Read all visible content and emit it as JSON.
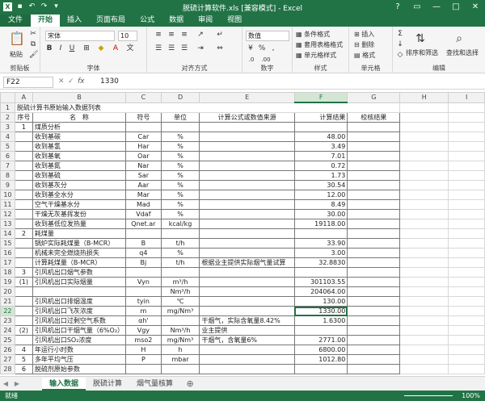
{
  "window": {
    "title": "脱硫计算软件.xls  [兼容模式] - Excel",
    "controls": {
      "help": "?",
      "ribbon": "▭",
      "minimize": "—",
      "restore": "□",
      "close": "✕"
    }
  },
  "tabs": [
    "文件",
    "开始",
    "插入",
    "页面布局",
    "公式",
    "数据",
    "审阅",
    "视图"
  ],
  "ribbon": {
    "clipboard": {
      "label": "剪贴板",
      "paste": "粘贴"
    },
    "font": {
      "label": "字体",
      "name": "宋体",
      "size": "10"
    },
    "alignment": {
      "label": "对齐方式"
    },
    "number": {
      "label": "数字",
      "format": "数值"
    },
    "styles": {
      "label": "样式",
      "conditional": "条件格式",
      "table": "套用表格格式",
      "cell": "单元格样式"
    },
    "cells": {
      "label": "单元格",
      "insert": "插入",
      "delete": "删除",
      "format": "格式"
    },
    "editing": {
      "label": "编辑",
      "sort": "排序和筛选",
      "find": "查找和选择"
    }
  },
  "formula_bar": {
    "name_box": "F22",
    "fx": "fx",
    "value": "1330"
  },
  "grid": {
    "columns": [
      "A",
      "B",
      "C",
      "D",
      "E",
      "F",
      "G",
      "H",
      "I"
    ],
    "selected_col": "F",
    "selected_row": "22",
    "rows": [
      {
        "n": "1",
        "a": "脱硫计算书原始输入数据列表",
        "b": "",
        "c": "",
        "d": "",
        "e": "",
        "f": "",
        "g": ""
      },
      {
        "n": "2",
        "a": "序号",
        "b": "名　称",
        "c": "符号",
        "d": "单位",
        "e": "计算公式或数值来源",
        "f": "计算结果",
        "g": "校核结果"
      },
      {
        "n": "3",
        "a": "1",
        "b": "煤质分析",
        "c": "",
        "d": "",
        "e": "",
        "f": "",
        "g": ""
      },
      {
        "n": "4",
        "a": "",
        "b": "收到基碳",
        "c": "Car",
        "d": "%",
        "e": "",
        "f": "48.00",
        "g": ""
      },
      {
        "n": "5",
        "a": "",
        "b": "收到基氢",
        "c": "Har",
        "d": "%",
        "e": "",
        "f": "3.49",
        "g": ""
      },
      {
        "n": "6",
        "a": "",
        "b": "收到基氧",
        "c": "Oar",
        "d": "%",
        "e": "",
        "f": "7.01",
        "g": ""
      },
      {
        "n": "7",
        "a": "",
        "b": "收到基氮",
        "c": "Nar",
        "d": "%",
        "e": "",
        "f": "0.72",
        "g": ""
      },
      {
        "n": "8",
        "a": "",
        "b": "收到基硫",
        "c": "Sar",
        "d": "%",
        "e": "",
        "f": "1.73",
        "g": ""
      },
      {
        "n": "9",
        "a": "",
        "b": "收到基灰分",
        "c": "Aar",
        "d": "%",
        "e": "",
        "f": "30.54",
        "g": ""
      },
      {
        "n": "10",
        "a": "",
        "b": "收到基全水分",
        "c": "Mar",
        "d": "%",
        "e": "",
        "f": "12.00",
        "g": ""
      },
      {
        "n": "11",
        "a": "",
        "b": "空气干燥基水分",
        "c": "Mad",
        "d": "%",
        "e": "",
        "f": "8.49",
        "g": ""
      },
      {
        "n": "12",
        "a": "",
        "b": "干燥无灰基挥发份",
        "c": "Vdaf",
        "d": "%",
        "e": "",
        "f": "30.00",
        "g": ""
      },
      {
        "n": "13",
        "a": "",
        "b": "收到基低位发热量",
        "c": "Qnet.ar",
        "d": "kcal/kg",
        "e": "",
        "f": "19118.00",
        "g": ""
      },
      {
        "n": "14",
        "a": "2",
        "b": "耗煤量",
        "c": "",
        "d": "",
        "e": "",
        "f": "",
        "g": ""
      },
      {
        "n": "15",
        "a": "",
        "b": "锅炉实际耗煤量（B-MCR）",
        "c": "B",
        "d": "t/h",
        "e": "",
        "f": "33.90",
        "g": ""
      },
      {
        "n": "16",
        "a": "",
        "b": "机械未完全燃烧热损失",
        "c": "q4",
        "d": "%",
        "e": "",
        "f": "3.00",
        "g": ""
      },
      {
        "n": "17",
        "a": "",
        "b": "计算耗煤量（B-MCR）",
        "c": "Bj",
        "d": "t/h",
        "e": "根据业主提供实际烟气量试算",
        "f": "32.8830",
        "g": ""
      },
      {
        "n": "18",
        "a": "3",
        "b": "引风机出口烟气参数",
        "c": "",
        "d": "",
        "e": "",
        "f": "",
        "g": ""
      },
      {
        "n": "19",
        "a": "(1)",
        "b": "引风机出口实际烟量",
        "c": "Vyn",
        "d": "m³/h",
        "e": "",
        "f": "301103.55",
        "g": ""
      },
      {
        "n": "20",
        "a": "",
        "b": "",
        "c": "",
        "d": "Nm³/h",
        "e": "",
        "f": "204064.00",
        "g": ""
      },
      {
        "n": "21",
        "a": "",
        "b": "引风机出口排烟温度",
        "c": "tyin",
        "d": "℃",
        "e": "",
        "f": "130.00",
        "g": ""
      },
      {
        "n": "22",
        "a": "",
        "b": "引风机出口飞灰浓度",
        "c": "m",
        "d": "mg/Nm³",
        "e": "",
        "f": "1330.00",
        "g": ""
      },
      {
        "n": "23",
        "a": "",
        "b": "引风机出口过剩空气系数",
        "c": "αh'",
        "d": "",
        "e": "干烟气，实际含氧量8.42%",
        "f": "1.6300",
        "g": ""
      },
      {
        "n": "24",
        "a": "(2)",
        "b": "引风机出口干烟气量（6%O₂）",
        "c": "Vgy",
        "d": "Nm³/h",
        "e": "业主提供",
        "f": "",
        "g": ""
      },
      {
        "n": "25",
        "a": "",
        "b": "引风机出口SO₂浓度",
        "c": "mso2",
        "d": "mg/Nm³",
        "e": "干烟气，含氧量6%",
        "f": "2771.00",
        "g": ""
      },
      {
        "n": "26",
        "a": "4",
        "b": "年运行小时数",
        "c": "H",
        "d": "h",
        "e": "",
        "f": "6800.00",
        "g": ""
      },
      {
        "n": "27",
        "a": "5",
        "b": "多年平均气压",
        "c": "P",
        "d": "mbar",
        "e": "",
        "f": "1012.80",
        "g": ""
      },
      {
        "n": "28",
        "a": "6",
        "b": "脱硫剂原始参数",
        "c": "",
        "d": "",
        "e": "",
        "f": "",
        "g": ""
      }
    ]
  },
  "sheets": [
    "输入数据",
    "脱硫计算",
    "烟气量核算"
  ],
  "active_sheet": 0,
  "status": {
    "left": "就绪",
    "zoom": "100%"
  }
}
